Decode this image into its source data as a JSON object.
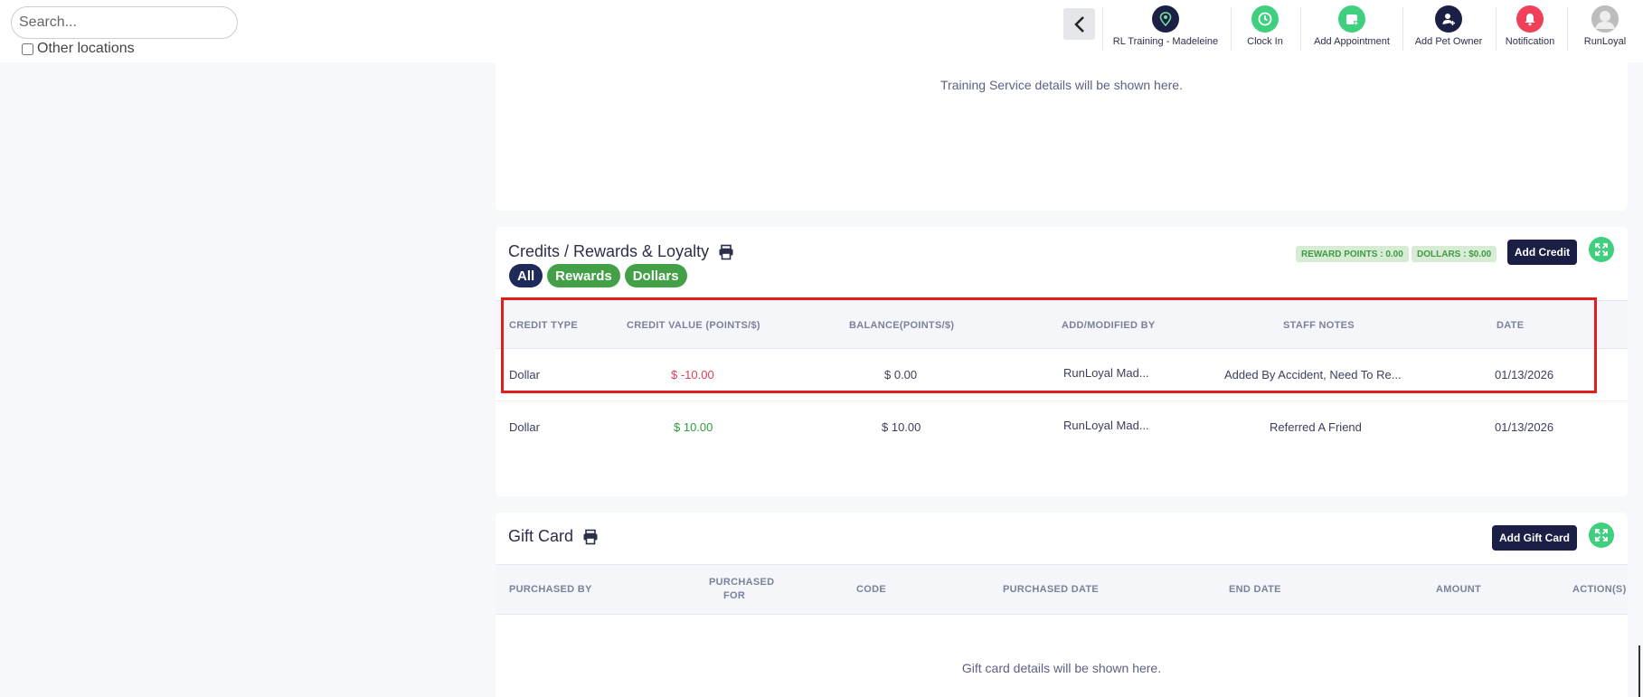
{
  "search": {
    "placeholder": "Search...",
    "value": ""
  },
  "other_locations": {
    "label": "Other locations",
    "checked": false
  },
  "nav": {
    "back_icon": "chevron-left-icon",
    "items": [
      {
        "label": "RL Training - Madeleine",
        "icon": "location-pin-icon",
        "color": "#1b1f45"
      },
      {
        "label": "Clock In",
        "icon": "clock-icon",
        "color": "#3fcf7e"
      },
      {
        "label": "Add Appointment",
        "icon": "calendar-plus-icon",
        "color": "#3fcf7e"
      },
      {
        "label": "Add Pet Owner",
        "icon": "user-plus-icon",
        "color": "#1b1f45"
      },
      {
        "label": "Notification",
        "icon": "bell-icon",
        "color": "#f0405a"
      },
      {
        "label": "RunLoyal",
        "icon": "avatar-icon",
        "color": "#c4c4c4"
      }
    ]
  },
  "training": {
    "empty_text": "Training Service details will be shown here."
  },
  "credits": {
    "title": "Credits / Rewards & Loyalty",
    "filters": [
      "All",
      "Rewards",
      "Dollars"
    ],
    "reward_points_badge": "REWARD POINTS : 0.00",
    "dollars_badge": "DOLLARS : $0.00",
    "add_button": "Add Credit",
    "columns": [
      "CREDIT TYPE",
      "CREDIT VALUE (POINTS/$)",
      "BALANCE(POINTS/$)",
      "ADD/MODIFIED BY",
      "STAFF NOTES",
      "DATE"
    ],
    "rows": [
      {
        "type": "Dollar",
        "value": "$ -10.00",
        "balance": "$ 0.00",
        "by": "RunLoyal Mad...",
        "notes": "Added By Accident, Need To Re...",
        "date": "01/13/2026"
      },
      {
        "type": "Dollar",
        "value": "$ 10.00",
        "balance": "$ 10.00",
        "by": "RunLoyal Mad...",
        "notes": "Referred A Friend",
        "date": "01/13/2026"
      }
    ]
  },
  "gift": {
    "title": "Gift Card",
    "add_button": "Add Gift Card",
    "columns": [
      "PURCHASED BY",
      "PURCHASED FOR",
      "CODE",
      "PURCHASED DATE",
      "END DATE",
      "AMOUNT",
      "ACTION(S)"
    ],
    "empty_text": "Gift card details will be shown here."
  },
  "colors": {
    "navy": "#1b1f45",
    "green": "#3fcf7e",
    "red": "#e83b56",
    "positive": "#2e9d3a",
    "highlight": "#e01e1e"
  }
}
